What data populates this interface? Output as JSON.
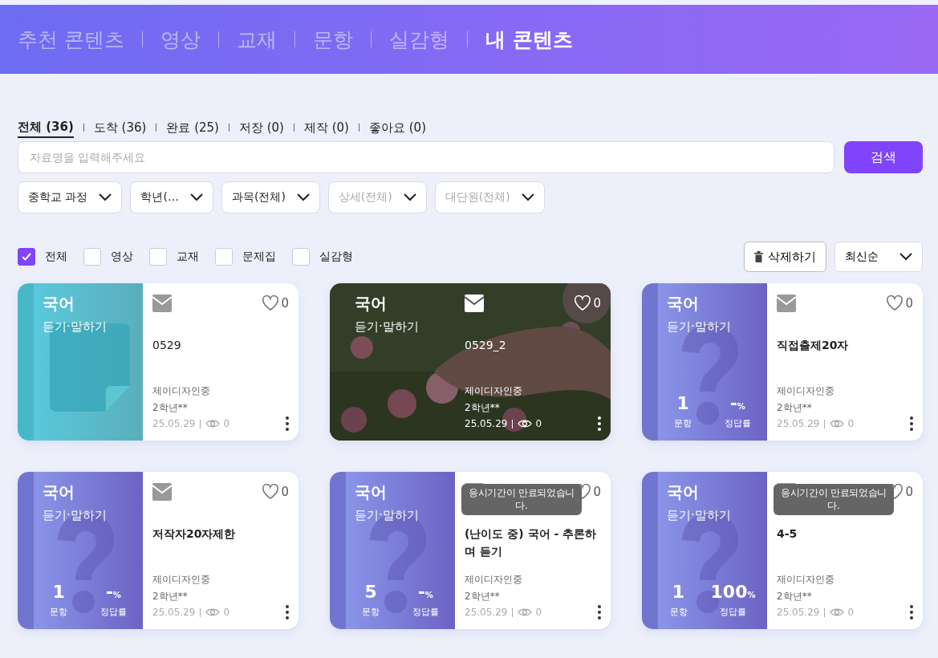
{
  "nav_tabs": [
    {
      "label": "추천 콘텐츠",
      "selected": false
    },
    {
      "label": "영상",
      "selected": false
    },
    {
      "label": "교재",
      "selected": false
    },
    {
      "label": "문항",
      "selected": false
    },
    {
      "label": "실감형",
      "selected": false
    },
    {
      "label": "내 콘텐츠",
      "selected": true
    }
  ],
  "filter_tabs": [
    {
      "label": "전체 (36)",
      "selected": true
    },
    {
      "label": "도착 (36)",
      "selected": false
    },
    {
      "label": "완료 (25)",
      "selected": false
    },
    {
      "label": "저장 (0)",
      "selected": false
    },
    {
      "label": "제작 (0)",
      "selected": false
    },
    {
      "label": "좋아요 (0)",
      "selected": false
    }
  ],
  "search": {
    "placeholder": "자료명을 입력해주세요",
    "button": "검색"
  },
  "dropdowns": [
    {
      "label": "중학교 과정",
      "disabled": false
    },
    {
      "label": "학년(…",
      "disabled": false
    },
    {
      "label": "과목(전체)",
      "disabled": false
    },
    {
      "label": "상세(전체)",
      "disabled": true
    },
    {
      "label": "대단원(전체)",
      "disabled": true
    }
  ],
  "type_filters": [
    {
      "label": "전체",
      "checked": true
    },
    {
      "label": "영상",
      "checked": false
    },
    {
      "label": "교재",
      "checked": false
    },
    {
      "label": "문제집",
      "checked": false
    },
    {
      "label": "실감형",
      "checked": false
    }
  ],
  "delete_button": "삭제하기",
  "sort": {
    "label": "최신순"
  },
  "cards": [
    {
      "kind": "document",
      "subject": "국어",
      "topic": "듣기·말하기",
      "title": "0529",
      "author": "제이디자인중",
      "grade": "2학년**",
      "date": "25.05.29",
      "views": "0",
      "likes": "0"
    },
    {
      "subject": "국어",
      "topic": "듣기·말하기",
      "title": "0529_2",
      "author": "제이디자인중",
      "grade": "2학년**",
      "date": "25.05.29",
      "views": "0",
      "likes": "0"
    },
    {
      "kind": "quiz",
      "subject": "국어",
      "topic": "듣기·말하기",
      "title": "직접출제20자",
      "author": "제이디자인중",
      "grade": "2학년**",
      "date": "25.05.29",
      "views": "0",
      "likes": "0",
      "stats": [
        {
          "value": "1",
          "label": "문항"
        },
        {
          "value": "-",
          "unit": "%",
          "label": "정답률"
        }
      ]
    },
    {
      "kind": "quiz",
      "subject": "국어",
      "topic": "듣기·말하기",
      "title": "저작자20자제한",
      "author": "제이디자인중",
      "grade": "2학년**",
      "date": "25.05.29",
      "views": "0",
      "likes": "0",
      "stats": [
        {
          "value": "1",
          "label": "문항"
        },
        {
          "value": "-",
          "unit": "%",
          "label": "정답률"
        }
      ]
    },
    {
      "kind": "quiz",
      "subject": "국어",
      "topic": "듣기·말하기",
      "title": "(난이도 중) 국어 - 추론하며 듣기",
      "author": "제이디자인중",
      "grade": "2학년**",
      "date": "25.05.29",
      "views": "0",
      "likes": "0",
      "notice": "응시기간이 만료되었습니다.",
      "stats": [
        {
          "value": "5",
          "label": "문항"
        },
        {
          "value": "-",
          "unit": "%",
          "label": "정답률"
        }
      ]
    },
    {
      "kind": "quiz",
      "subject": "국어",
      "topic": "듣기·말하기",
      "title": "4-5",
      "author": "제이디자인중",
      "grade": "2학년**",
      "date": "25.05.29",
      "views": "0",
      "likes": "0",
      "notice": "응시기간이 만료되었습니다.",
      "stats": [
        {
          "value": "1",
          "label": "문항"
        },
        {
          "value": "100",
          "unit": "%",
          "label": "정답률"
        }
      ]
    }
  ]
}
